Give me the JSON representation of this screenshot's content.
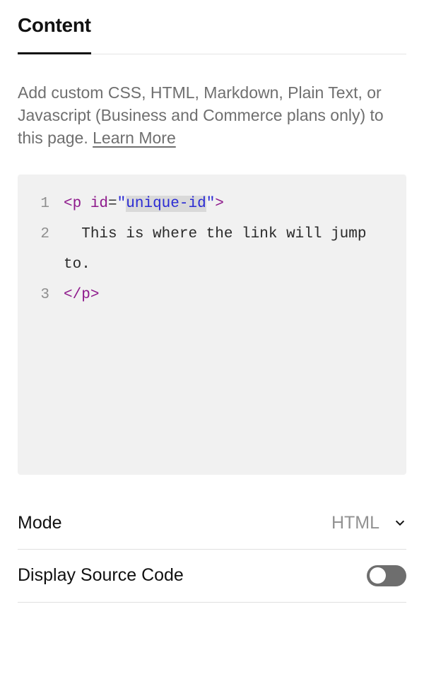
{
  "tab": {
    "label": "Content"
  },
  "description": {
    "text": "Add custom CSS, HTML, Markdown, Plain Text, or Javascript (Business and Commerce plans only) to this page. ",
    "learn_more_label": "Learn More"
  },
  "code": {
    "lines": [
      {
        "num": "1",
        "tokens": [
          {
            "t": "bracket",
            "v": "<"
          },
          {
            "t": "tagname",
            "v": "p"
          },
          {
            "t": "text",
            "v": " "
          },
          {
            "t": "attr",
            "v": "id"
          },
          {
            "t": "eq",
            "v": "="
          },
          {
            "t": "string",
            "v": "\""
          },
          {
            "t": "string-h",
            "v": "unique-id"
          },
          {
            "t": "string",
            "v": "\""
          },
          {
            "t": "bracket",
            "v": ">"
          }
        ]
      },
      {
        "num": "2",
        "tokens": [
          {
            "t": "text",
            "v": "  This is where the link will jump to."
          }
        ]
      },
      {
        "num": "3",
        "tokens": [
          {
            "t": "bracket",
            "v": "<"
          },
          {
            "t": "bracket",
            "v": "/"
          },
          {
            "t": "tagname",
            "v": "p"
          },
          {
            "t": "bracket",
            "v": ">"
          }
        ]
      }
    ]
  },
  "settings": {
    "mode": {
      "label": "Mode",
      "value": "HTML"
    },
    "display_source": {
      "label": "Display Source Code",
      "on": false
    }
  }
}
